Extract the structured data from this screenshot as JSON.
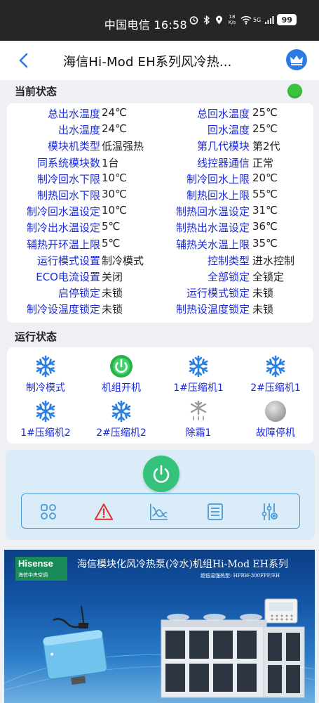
{
  "status_bar": {
    "carrier_time": "中国电信 16:58",
    "speed": "18\nK/s",
    "network": "5G",
    "battery": "99"
  },
  "header": {
    "title": "海信Hi-Mod EH系列风冷热..."
  },
  "current_status": {
    "label": "当前状态",
    "indicator_color": "#3cc23c",
    "rows": [
      {
        "l1": "总出水温度",
        "v1": "24℃",
        "l2": "总回水温度",
        "v2": "25℃"
      },
      {
        "l1": "出水温度",
        "v1": "24℃",
        "l2": "回水温度",
        "v2": "25℃"
      },
      {
        "l1": "模块机类型",
        "v1": "低温强热",
        "l2": "第几代模块",
        "v2": "第2代"
      },
      {
        "l1": "同系统模块数",
        "v1": "1台",
        "l2": "线控器通信",
        "v2": "正常"
      },
      {
        "l1": "制冷回水下限",
        "v1": "10℃",
        "l2": "制冷回水上限",
        "v2": "20℃"
      },
      {
        "l1": "制热回水下限",
        "v1": "30℃",
        "l2": "制热回水上限",
        "v2": "55℃"
      },
      {
        "l1": "制冷回水温设定",
        "v1": "10℃",
        "l2": "制热回水温设定",
        "v2": "31℃"
      },
      {
        "l1": "制冷出水温设定",
        "v1": "5℃",
        "l2": "制热出水温设定",
        "v2": "36℃"
      },
      {
        "l1": "辅热开环温上限",
        "v1": "5℃",
        "l2": "辅热关水温上限",
        "v2": "35℃"
      },
      {
        "l1": "运行模式设置",
        "v1": "制冷模式",
        "l2": "控制类型",
        "v2": "进水控制"
      },
      {
        "l1": "ECO电流设置",
        "v1": "关闭",
        "l2": "全部锁定",
        "v2": "全锁定"
      },
      {
        "l1": "启停锁定",
        "v1": "未锁",
        "l2": "运行模式锁定",
        "v2": "未锁"
      },
      {
        "l1": "制冷设温度锁定",
        "v1": "未锁",
        "l2": "制热设温度锁定",
        "v2": "未锁"
      }
    ]
  },
  "run_status": {
    "label": "运行状态",
    "items": [
      {
        "label": "制冷模式",
        "icon": "snowflake-icon"
      },
      {
        "label": "机组开机",
        "icon": "power-on-icon"
      },
      {
        "label": "1#压缩机1",
        "icon": "snowflake-icon"
      },
      {
        "label": "2#压缩机1",
        "icon": "snowflake-icon"
      },
      {
        "label": "1#压缩机2",
        "icon": "snowflake-icon"
      },
      {
        "label": "2#压缩机2",
        "icon": "snowflake-icon"
      },
      {
        "label": "除霜1",
        "icon": "defrost-icon"
      },
      {
        "label": "故障停机",
        "icon": "fault-indicator-icon"
      }
    ]
  },
  "colors": {
    "label_blue": "#1c2bd8",
    "icon_blue": "#2a7fe0",
    "power_green": "#35c27a",
    "toolbar_blue": "#4a9ad4",
    "alert_red": "#e03030"
  },
  "banner": {
    "logo_brand": "Hisense",
    "logo_sub": "海信中央空调",
    "title": "海信模块化风冷热泵(冷水)机组Hi-Mod EH系列",
    "subtitle": "超低温强热型: HFRW-300FPF/EH"
  }
}
